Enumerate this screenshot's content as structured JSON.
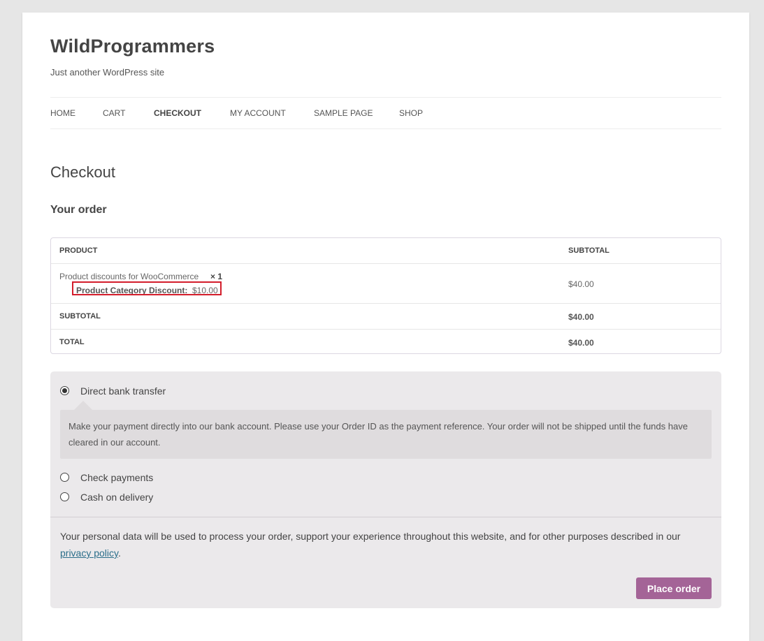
{
  "site": {
    "title": "WildProgrammers",
    "tagline": "Just another WordPress site"
  },
  "nav": {
    "items": [
      {
        "label": "HOME",
        "active": false
      },
      {
        "label": "CART",
        "active": false
      },
      {
        "label": "CHECKOUT",
        "active": true
      },
      {
        "label": "MY ACCOUNT",
        "active": false
      },
      {
        "label": "SAMPLE PAGE",
        "active": false
      },
      {
        "label": "SHOP",
        "active": false
      }
    ]
  },
  "page": {
    "title": "Checkout",
    "order_heading": "Your order"
  },
  "order_table": {
    "headers": {
      "product": "PRODUCT",
      "subtotal": "SUBTOTAL"
    },
    "item": {
      "name": "Product discounts for WooCommerce",
      "quantity": "× 1",
      "discount_label": "Product Category Discount:",
      "discount_value": "$10.00",
      "subtotal": "$40.00"
    },
    "subtotal": {
      "label": "SUBTOTAL",
      "value": "$40.00"
    },
    "total": {
      "label": "TOTAL",
      "value": "$40.00"
    }
  },
  "payment": {
    "methods": [
      {
        "label": "Direct bank transfer",
        "selected": true
      },
      {
        "label": "Check payments",
        "selected": false
      },
      {
        "label": "Cash on delivery",
        "selected": false
      }
    ],
    "bank_description": "Make your payment directly into our bank account. Please use your Order ID as the payment reference. Your order will not be shipped until the funds have cleared in our account."
  },
  "privacy": {
    "text_before": "Your personal data will be used to process your order, support your experience throughout this website, and for other purposes described in our ",
    "link": "privacy policy",
    "text_after": "."
  },
  "place_order_label": "Place order",
  "colors": {
    "button": "#a46497",
    "highlight_box": "#d31d2b",
    "payment_bg": "#ebe9eb",
    "link": "#2b6e8a"
  }
}
